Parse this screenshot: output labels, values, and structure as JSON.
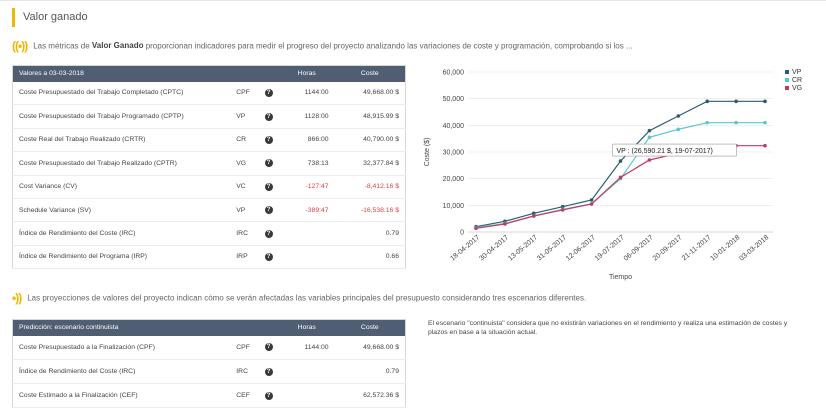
{
  "section": {
    "title": "Valor ganado",
    "intro_pre": "Las métricas de ",
    "intro_bold": "Valor Ganado",
    "intro_post": " proporcionan indicadores para medir el progreso del proyecto analizando las variaciones de coste y programación, comprobando si los ..."
  },
  "metrics_table": {
    "header": {
      "label": "Valores a 03-03-2018",
      "hours": "Horas",
      "cost": "Coste"
    },
    "rows": [
      {
        "label": "Coste Presupuestado del Trabajo Completado (CPTC)",
        "code": "CPF",
        "hours": "1144:00",
        "cost": "49,668.00 $",
        "neg": false
      },
      {
        "label": "Coste Presupuestado del Trabajo Programado (CPTP)",
        "code": "VP",
        "hours": "1128:00",
        "cost": "48,915.99 $",
        "neg": false
      },
      {
        "label": "Coste Real del Trabajo Realizado (CRTR)",
        "code": "CR",
        "hours": "866:00",
        "cost": "40,790.00 $",
        "neg": false
      },
      {
        "label": "Coste Presupuestado del Trabajo Realizado (CPTR)",
        "code": "VG",
        "hours": "738:13",
        "cost": "32,377.84 $",
        "neg": false
      },
      {
        "label": "Cost Variance (CV)",
        "code": "VC",
        "hours": "-127:47",
        "cost": "-8,412.16 $",
        "neg": true
      },
      {
        "label": "Schedule Variance (SV)",
        "code": "VP",
        "hours": "-389:47",
        "cost": "-16,538.16 $",
        "neg": true
      },
      {
        "label": "Índice de Rendimiento del Coste (IRC)",
        "code": "IRC",
        "hours": "",
        "cost": "0.79",
        "neg": false
      },
      {
        "label": "Índice de Rendimiento del Programa (IRP)",
        "code": "IRP",
        "hours": "",
        "cost": "0.66",
        "neg": false
      }
    ]
  },
  "projections": {
    "text": "Las proyecciones de valores del proyecto indican cómo se verán afectadas las variables principales del presupuesto considerando tres escenarios diferentes."
  },
  "forecast_table": {
    "header": {
      "label": "Predicción: escenario continuista",
      "hours": "Horas",
      "cost": "Coste"
    },
    "rows": [
      {
        "label": "Coste Presupuestado a la Finalización (CPF)",
        "code": "CPF",
        "hours": "1144:00",
        "cost": "49,668.00 $"
      },
      {
        "label": "Índice de Rendimiento del Coste (IRC)",
        "code": "IRC",
        "hours": "",
        "cost": "0.79"
      },
      {
        "label": "Coste Estimado a la Finalización (CEF)",
        "code": "CEF",
        "hours": "",
        "cost": "62,572.36 $"
      }
    ]
  },
  "scenario_note": "El escenario \"continuista\" considera que no existirán variaciones en el rendimiento y realiza una estimación de costes y plazos en base a la situación actual.",
  "icons": {
    "radio": "broadcast-icon",
    "help": "help-circle-icon"
  },
  "colors": {
    "accent": "#f2b600",
    "header": "#4f5e72",
    "negative": "#d9464a"
  },
  "chart_data": {
    "type": "line",
    "xlabel": "Tiempo",
    "ylabel": "Coste ($)",
    "ylim": [
      0,
      60000
    ],
    "yticks": [
      "0",
      "10,000",
      "20,000",
      "30,000",
      "40,000",
      "50,000",
      "60,000"
    ],
    "categories": [
      "18-04-2017",
      "30-04-2017",
      "13-05-2017",
      "31-05-2017",
      "12-06-2017",
      "19-07-2017",
      "06-09-2017",
      "20-09-2017",
      "21-11-2017",
      "10-01-2018",
      "03-03-2018"
    ],
    "legend_position": "top-right",
    "series": [
      {
        "name": "VP",
        "color": "#2b5c73",
        "values": [
          2000,
          4000,
          7000,
          9500,
          12000,
          26590.21,
          38000,
          43500,
          49000,
          49000,
          49000
        ]
      },
      {
        "name": "CR",
        "color": "#57c8cc",
        "values": [
          1600,
          3200,
          6000,
          8500,
          10500,
          20000,
          35500,
          38500,
          41000,
          41000,
          41000
        ]
      },
      {
        "name": "VG",
        "color": "#c23a63",
        "values": [
          1400,
          3000,
          6000,
          8300,
          10500,
          20500,
          27000,
          29500,
          null,
          32377.84,
          32377.84
        ]
      }
    ],
    "tooltip": "VP : (26,590.21 $, 19-07-2017)"
  }
}
